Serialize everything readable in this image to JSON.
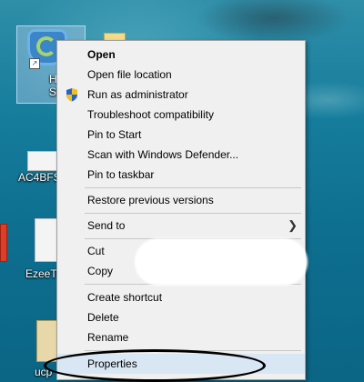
{
  "desktop": {
    "icons": [
      {
        "label_line1": "Hotsp",
        "label_line2": "Shie"
      },
      {
        "label": "AC4BFS"
      },
      {
        "label": "EzeeTr"
      },
      {
        "label": "ucp"
      }
    ]
  },
  "context_menu": {
    "items": [
      {
        "label": "Open",
        "bold": true
      },
      {
        "label": "Open file location"
      },
      {
        "label": "Run as administrator",
        "icon": "uac-shield-icon"
      },
      {
        "label": "Troubleshoot compatibility"
      },
      {
        "label": "Pin to Start"
      },
      {
        "label": "Scan with Windows Defender..."
      },
      {
        "label": "Pin to taskbar"
      },
      {
        "label": "Restore previous versions"
      },
      {
        "label": "Send to",
        "submenu": true
      },
      {
        "label": "Cut"
      },
      {
        "label": "Copy"
      },
      {
        "label": "Create shortcut"
      },
      {
        "label": "Delete"
      },
      {
        "label": "Rename"
      },
      {
        "label": "Properties",
        "highlighted": true
      }
    ]
  },
  "colors": {
    "menu_bg": "#f0f0f0",
    "highlight": "#d9e6f3",
    "annotation": "#000000"
  }
}
